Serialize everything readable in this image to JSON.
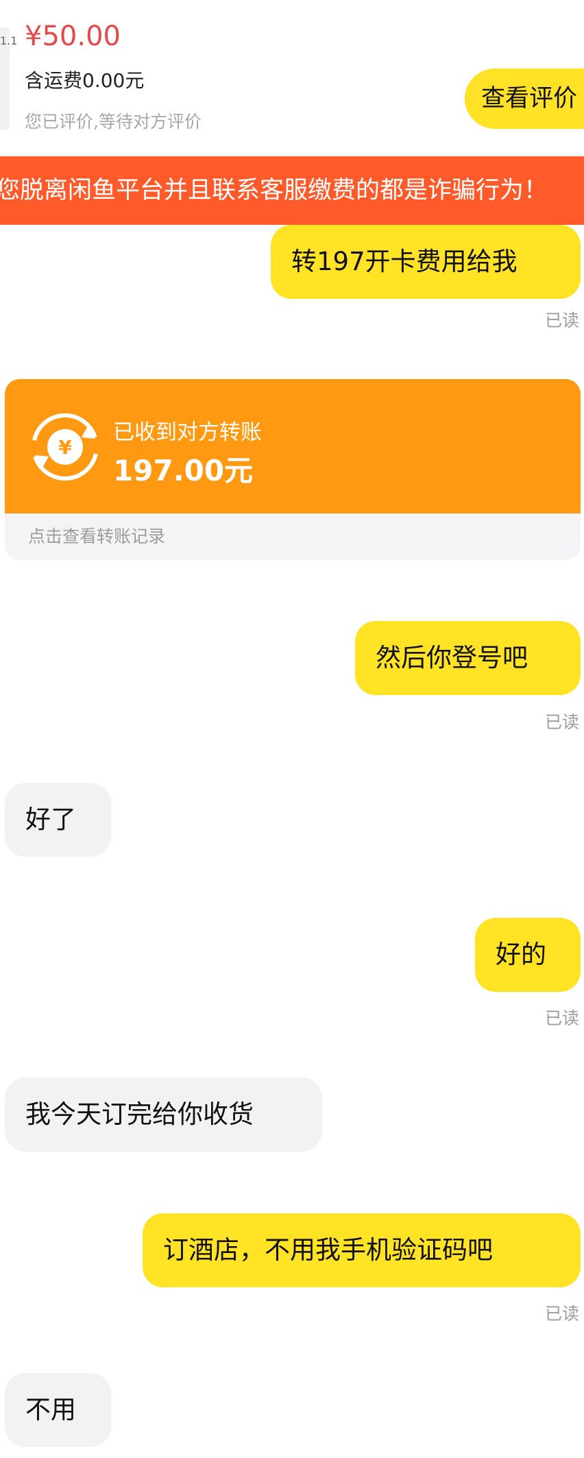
{
  "order": {
    "thumb_text": "1.1",
    "price": "¥50.00",
    "shipping": "含运费0.00元",
    "status": "您已评价,等待对方评价",
    "review_button": "查看评价"
  },
  "warning": "您脱离闲鱼平台并且联系客服缴费的都是诈骗行为！",
  "messages": {
    "m1": {
      "text": "转197开卡费用给我",
      "read": "已读"
    },
    "transfer": {
      "title": "已收到对方转账",
      "amount": "197.00元",
      "footer": "点击查看转账记录",
      "icon": "yen-exchange-icon"
    },
    "m2": {
      "text": "然后你登号吧",
      "read": "已读"
    },
    "m3": {
      "text": "好了"
    },
    "m4": {
      "text": "好的",
      "read": "已读"
    },
    "m5": {
      "text": "我今天订完给你收货"
    },
    "m6": {
      "text": "订酒店，不用我手机验证码吧",
      "read": "已读"
    },
    "m7": {
      "text": "不用"
    }
  },
  "colors": {
    "accent_yellow": "#ffe324",
    "price_red": "#e8474a",
    "warning_orange": "#ff5a2a",
    "transfer_orange": "#ff9912",
    "incoming_bubble": "#f2f2f4"
  }
}
